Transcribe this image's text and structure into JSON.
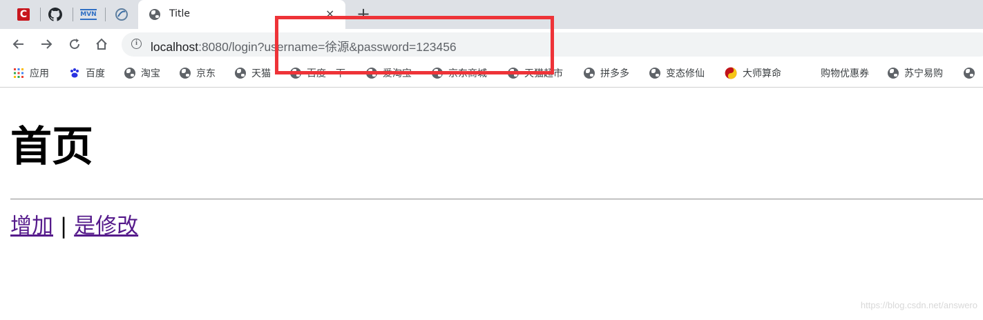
{
  "tab": {
    "title": "Title",
    "close": "×",
    "new_tab": "+"
  },
  "pinned_tabs": [
    {
      "name": "csdn-icon",
      "letter": "C"
    },
    {
      "name": "github-icon"
    },
    {
      "name": "mvn-icon",
      "text": "MVN"
    },
    {
      "name": "spring-icon"
    }
  ],
  "address": {
    "host": "localhost",
    "rest": ":8080/login?username=徐源&password=123456"
  },
  "bookmarks": [
    {
      "label": "应用",
      "icon": "apps-grid-icon"
    },
    {
      "label": "百度",
      "icon": "baidu-paw-icon"
    },
    {
      "label": "淘宝",
      "icon": "globe-icon"
    },
    {
      "label": "京东",
      "icon": "globe-icon"
    },
    {
      "label": "天猫",
      "icon": "globe-icon"
    },
    {
      "label": "百度一下",
      "icon": "globe-icon"
    },
    {
      "label": "爱淘宝",
      "icon": "globe-icon"
    },
    {
      "label": "京东商城",
      "icon": "globe-icon"
    },
    {
      "label": "天猫超市",
      "icon": "globe-icon"
    },
    {
      "label": "拼多多",
      "icon": "globe-icon"
    },
    {
      "label": "变态修仙",
      "icon": "globe-icon"
    },
    {
      "label": "大师算命",
      "icon": "taiji-icon"
    },
    {
      "label": "购物优惠券",
      "icon": "none"
    },
    {
      "label": "苏宁易购",
      "icon": "globe-icon"
    }
  ],
  "page": {
    "heading": "首页",
    "links": [
      "增加",
      "是修改"
    ],
    "separator": " | "
  },
  "watermark": "https://blog.csdn.net/answero",
  "colors": {
    "annotation": "#ee3338",
    "visited_link": "#551a8b",
    "tabstrip": "#dee1e6"
  }
}
